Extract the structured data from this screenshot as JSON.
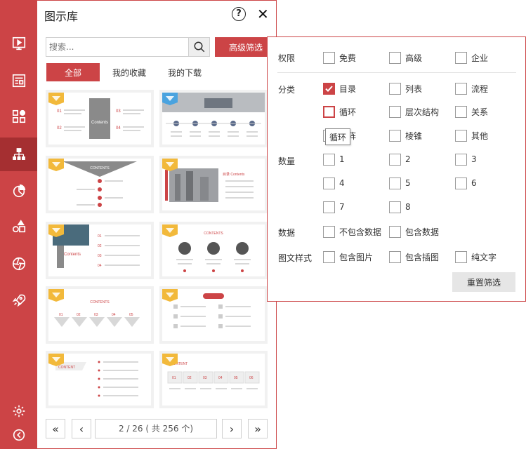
{
  "sidebar": {
    "items": [
      {
        "name": "slideshow-icon",
        "active": false
      },
      {
        "name": "layout-icon",
        "active": false
      },
      {
        "name": "grid-shapes-icon",
        "active": false
      },
      {
        "name": "org-chart-icon",
        "active": true
      },
      {
        "name": "pie-chart-icon",
        "active": false
      },
      {
        "name": "shapes-icon",
        "active": false
      },
      {
        "name": "aperture-icon",
        "active": false
      },
      {
        "name": "rocket-icon",
        "active": false
      }
    ],
    "bottom": [
      {
        "name": "settings-icon"
      },
      {
        "name": "back-icon"
      }
    ]
  },
  "panel": {
    "title": "图示库",
    "help": "?",
    "close": "✕",
    "search_placeholder": "搜索...",
    "advanced_filter": "高级筛选",
    "tabs": [
      {
        "label": "全部",
        "active": true
      },
      {
        "label": "我的收藏",
        "active": false
      },
      {
        "label": "我的下载",
        "active": false
      }
    ],
    "thumbnails": [
      {
        "gem": "gold",
        "title": "Contents"
      },
      {
        "gem": "blue",
        "title": "CONTENTS"
      },
      {
        "gem": "gold",
        "title": "CONTENTS"
      },
      {
        "gem": "gold",
        "title": "目录 Contents"
      },
      {
        "gem": "gold",
        "title": "Contents"
      },
      {
        "gem": "gold",
        "title": "CONTENTS"
      },
      {
        "gem": "gold",
        "title": "CONTENTS"
      },
      {
        "gem": "gold",
        "title": "Contents"
      },
      {
        "gem": "gold",
        "title": "CONTENT"
      },
      {
        "gem": "gold",
        "title": "CONTENT"
      }
    ],
    "pager": {
      "first": "«",
      "prev": "‹",
      "status": "2 / 26 ( 共 256 个)",
      "next": "›",
      "last": "»"
    }
  },
  "filter": {
    "groups": {
      "permission": {
        "label": "权限",
        "options": [
          {
            "label": "免费",
            "checked": false
          },
          {
            "label": "高级",
            "checked": false
          },
          {
            "label": "企业",
            "checked": false
          }
        ]
      },
      "category": {
        "label": "分类",
        "options": [
          {
            "label": "目录",
            "checked": true
          },
          {
            "label": "列表",
            "checked": false
          },
          {
            "label": "流程",
            "checked": false
          },
          {
            "label": "循环",
            "checked": false,
            "hover": true
          },
          {
            "label": "层次结构",
            "checked": false
          },
          {
            "label": "关系",
            "checked": false
          },
          {
            "label": "矩阵",
            "checked": false
          },
          {
            "label": "棱锥",
            "checked": false
          },
          {
            "label": "其他",
            "checked": false
          }
        ]
      },
      "count": {
        "label": "数量",
        "options": [
          {
            "label": "1"
          },
          {
            "label": "2"
          },
          {
            "label": "3"
          },
          {
            "label": "4"
          },
          {
            "label": "5"
          },
          {
            "label": "6"
          },
          {
            "label": "7"
          },
          {
            "label": "8"
          }
        ]
      },
      "data": {
        "label": "数据",
        "options": [
          {
            "label": "不包含数据"
          },
          {
            "label": "包含数据"
          }
        ]
      },
      "style": {
        "label": "图文样式",
        "options": [
          {
            "label": "包含图片"
          },
          {
            "label": "包含插图"
          },
          {
            "label": "纯文字"
          }
        ]
      }
    },
    "reset": "重置筛选",
    "tooltip": "循环"
  },
  "colors": {
    "accent": "#cc4446",
    "accent_dark": "#a52f31",
    "gem_gold": "#f2b93b",
    "gem_blue": "#4aa3df"
  }
}
